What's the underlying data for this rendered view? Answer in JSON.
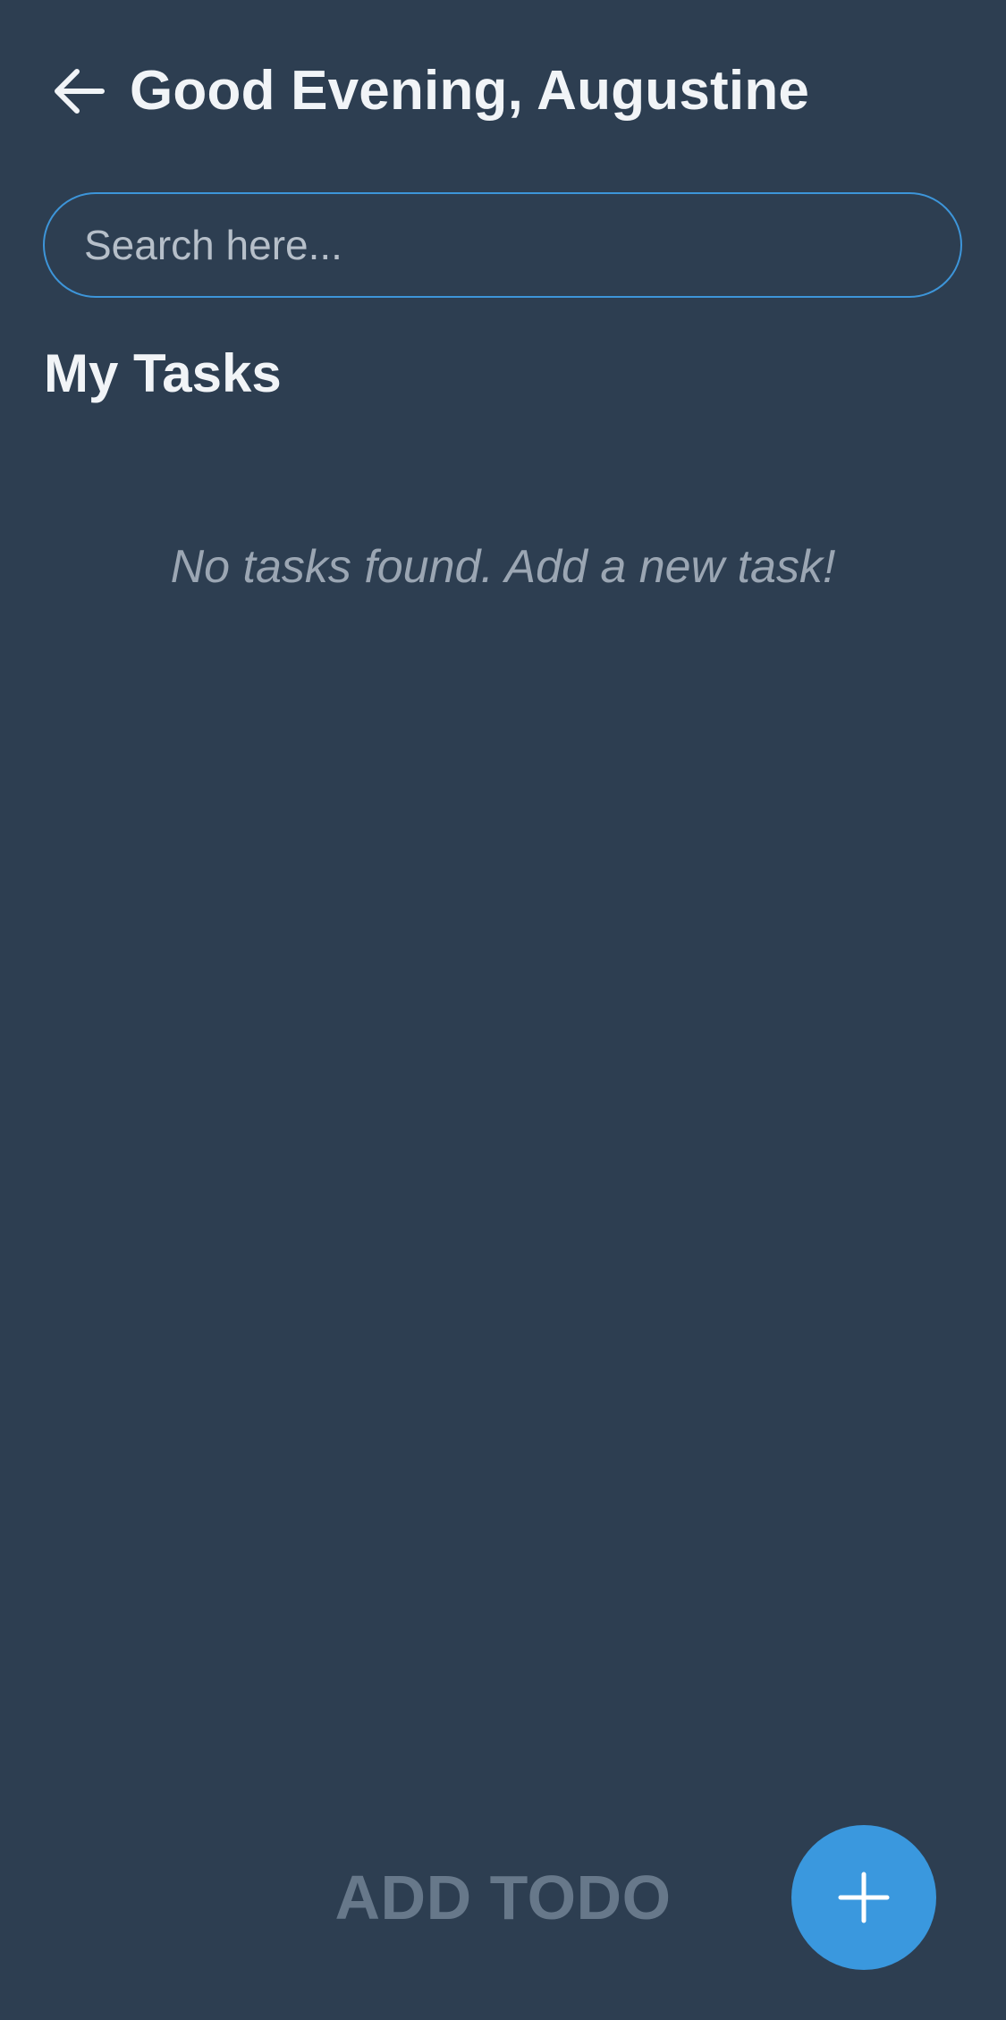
{
  "header": {
    "back_icon": "arrow-left-icon",
    "greeting": "Good Evening, Augustine"
  },
  "search": {
    "placeholder": "Search here...",
    "value": ""
  },
  "tasks": {
    "section_title": "My Tasks",
    "items": [],
    "empty_message": "No tasks found. Add a new task!"
  },
  "footer": {
    "add_todo_label": "ADD TODO",
    "fab_icon": "plus-icon"
  },
  "colors": {
    "background": "#2d3e51",
    "accent": "#3a98de",
    "search_border": "#3d95d9",
    "primary_text": "#f1f4f7",
    "muted_text": "#9ba6b3",
    "disabled_label": "#67788a"
  }
}
